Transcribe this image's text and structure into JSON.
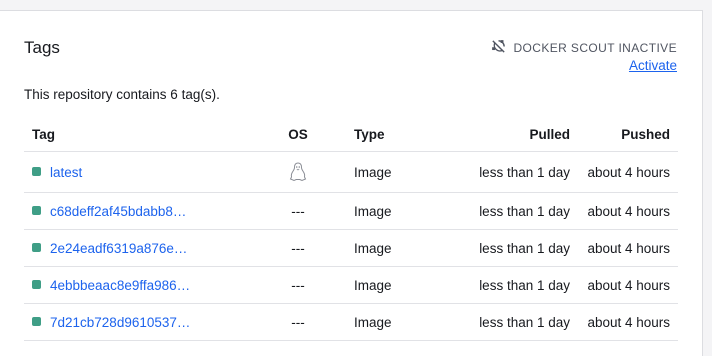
{
  "header": {
    "title": "Tags"
  },
  "scout": {
    "status": "DOCKER SCOUT INACTIVE",
    "activate": "Activate",
    "icon": "scout-off-icon"
  },
  "summary": "This repository contains 6 tag(s).",
  "columns": {
    "tag": "Tag",
    "os": "OS",
    "type": "Type",
    "pulled": "Pulled",
    "pushed": "Pushed"
  },
  "rows": [
    {
      "tag": "latest",
      "os": "linux-icon",
      "type": "Image",
      "pulled": "less than 1 day",
      "pushed": "about 4 hours"
    },
    {
      "tag": "c68deff2af45bdabb8…",
      "os": "---",
      "type": "Image",
      "pulled": "less than 1 day",
      "pushed": "about 4 hours"
    },
    {
      "tag": "2e24eadf6319a876e…",
      "os": "---",
      "type": "Image",
      "pulled": "less than 1 day",
      "pushed": "about 4 hours"
    },
    {
      "tag": "4ebbbeaac8e9ffa986…",
      "os": "---",
      "type": "Image",
      "pulled": "less than 1 day",
      "pushed": "about 4 hours"
    },
    {
      "tag": "7d21cb728d9610537…",
      "os": "---",
      "type": "Image",
      "pulled": "less than 1 day",
      "pushed": "about 4 hours"
    }
  ],
  "colors": {
    "accent": "#1d63ed",
    "status_dot": "#3f9e86"
  }
}
